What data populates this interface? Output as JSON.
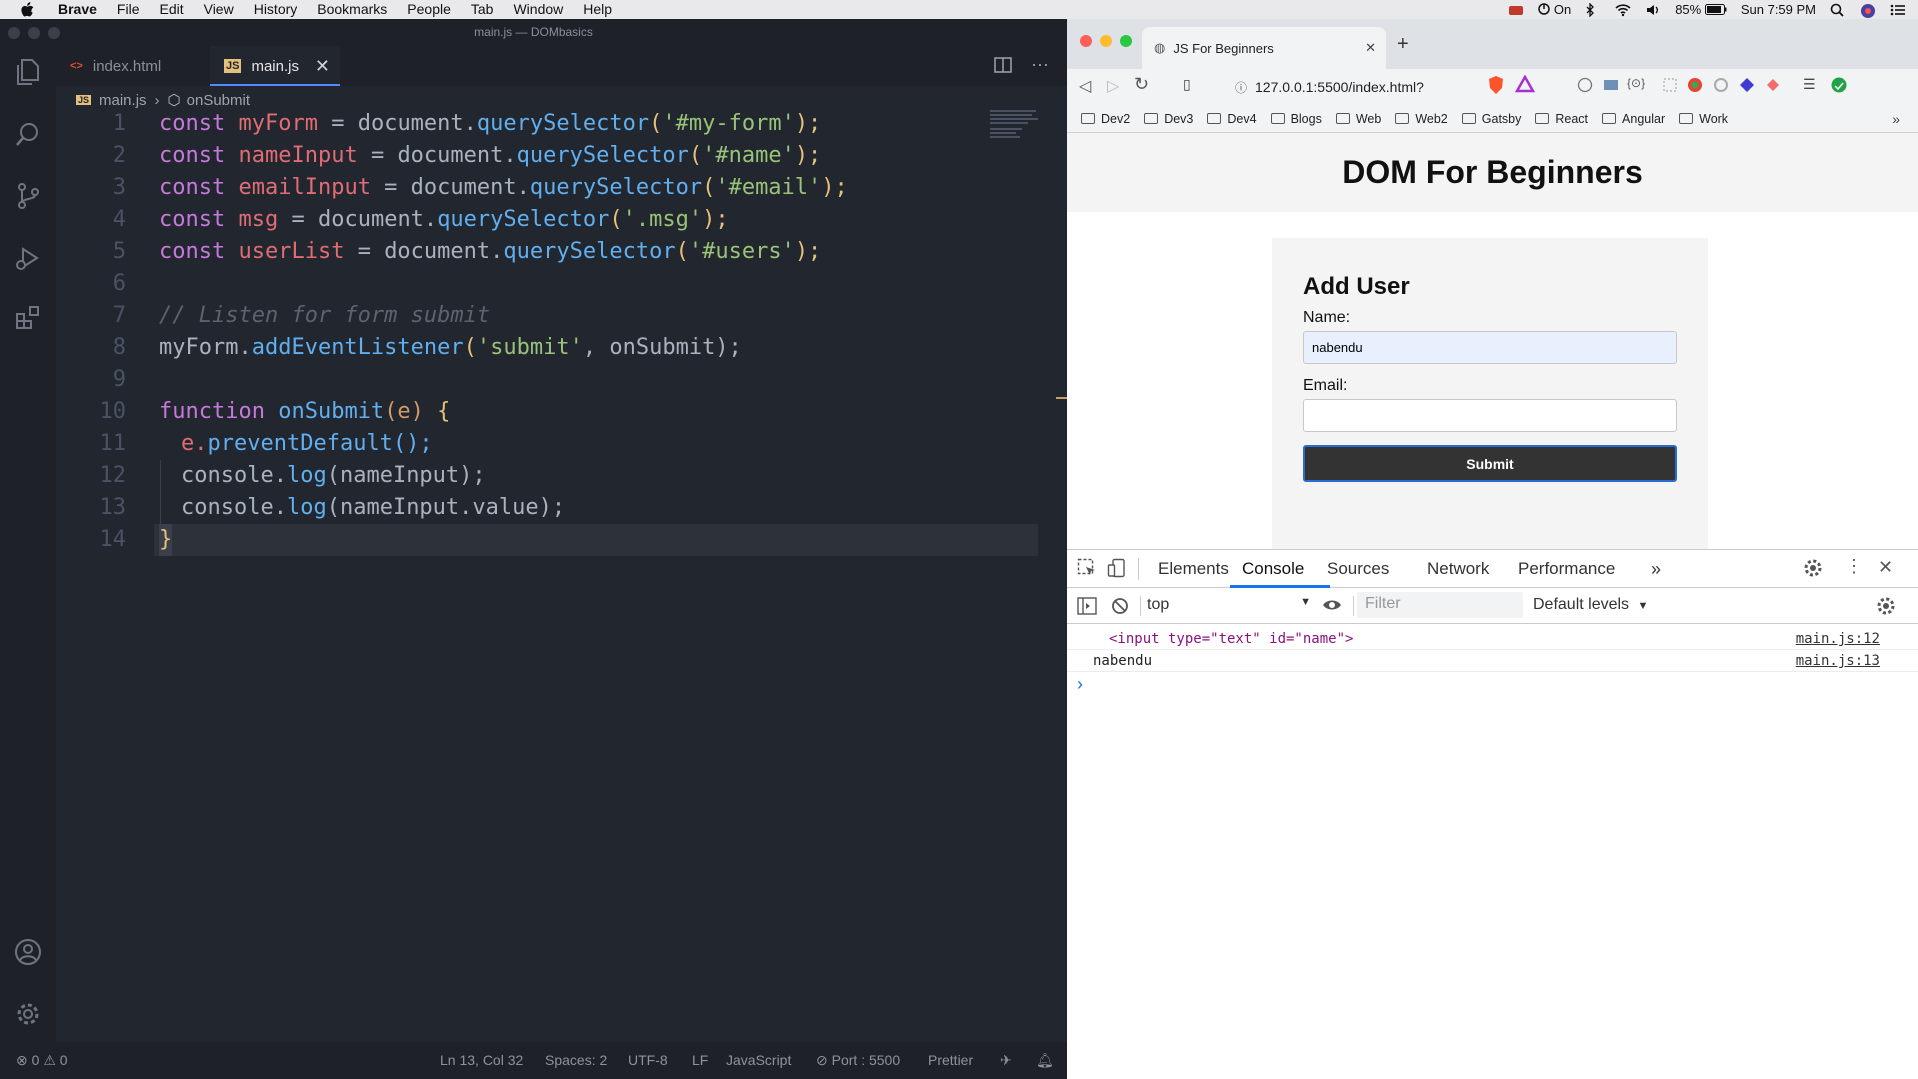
{
  "menubar": {
    "app": "Brave",
    "items": [
      "File",
      "Edit",
      "View",
      "History",
      "Bookmarks",
      "People",
      "Tab",
      "Window",
      "Help"
    ],
    "status": {
      "vpn": "On",
      "battery": "85%",
      "clock": "Sun 7:59 PM"
    }
  },
  "vscode": {
    "title": "main.js — DOMbasics",
    "tabs": [
      {
        "label": "index.html",
        "icon": "html-file-icon"
      },
      {
        "label": "main.js",
        "icon": "js-file-icon"
      }
    ],
    "breadcrumb": {
      "file": "main.js",
      "symbol": "onSubmit"
    },
    "line_numbers": [
      "1",
      "2",
      "3",
      "4",
      "5",
      "6",
      "7",
      "8",
      "9",
      "10",
      "11",
      "12",
      "13",
      "14"
    ],
    "code": {
      "l1": {
        "kw": "const",
        "var": "myForm",
        "eq": " = document.",
        "fn": "querySelector",
        "open": "(",
        "str": "'#my-form'",
        "close": ");"
      },
      "l2": {
        "kw": "const",
        "var": "nameInput",
        "eq": " = document.",
        "fn": "querySelector",
        "open": "(",
        "str": "'#name'",
        "close": ");"
      },
      "l3": {
        "kw": "const",
        "var": "emailInput",
        "eq": " = document.",
        "fn": "querySelector",
        "open": "(",
        "str": "'#email'",
        "close": ");"
      },
      "l4": {
        "kw": "const",
        "var": "msg",
        "eq": " = document.",
        "fn": "querySelector",
        "open": "(",
        "str": "'.msg'",
        "close": ");"
      },
      "l5": {
        "kw": "const",
        "var": "userList",
        "eq": " = document.",
        "fn": "querySelector",
        "open": "(",
        "str": "'#users'",
        "close": ");"
      },
      "l7": "// Listen for form submit",
      "l8": {
        "obj": "myForm.",
        "fn": "addEventListener",
        "open": "(",
        "str": "'submit'",
        "rest": ", onSubmit);"
      },
      "l10": {
        "kw": "function",
        "fn": "onSubmit",
        "param": "(e)",
        "brace": " {"
      },
      "l11": {
        "obj": "e.",
        "fn": "preventDefault",
        "rest": "();"
      },
      "l12": {
        "obj": "console.",
        "fn": "log",
        "rest": "(nameInput);"
      },
      "l13": {
        "obj": "console.",
        "fn": "log",
        "rest": "(nameInput.value);"
      },
      "l14": "}"
    },
    "status": {
      "problems": "0",
      "warnings": "0",
      "cursor": "Ln 13, Col 32",
      "spaces": "Spaces: 2",
      "encoding": "UTF-8",
      "eol": "LF",
      "language": "JavaScript",
      "port": "Port : 5500",
      "formatter": "Prettier"
    }
  },
  "browser": {
    "tab_title": "JS For Beginners",
    "url": "127.0.0.1:5500/index.html?",
    "bookmarks": [
      "Dev2",
      "Dev3",
      "Dev4",
      "Blogs",
      "Web",
      "Web2",
      "Gatsby",
      "React",
      "Angular",
      "Work"
    ],
    "page": {
      "heading": "DOM For Beginners",
      "form_title": "Add User",
      "name_label": "Name:",
      "name_value": "nabendu",
      "email_label": "Email:",
      "email_value": "",
      "submit_label": "Submit"
    }
  },
  "devtools": {
    "tabs": [
      "Elements",
      "Console",
      "Sources",
      "Network",
      "Performance"
    ],
    "active_tab": "Console",
    "context": "top",
    "filter_placeholder": "Filter",
    "levels": "Default levels",
    "logs": [
      {
        "text": "<input type=\"text\" id=\"name\">",
        "source": "main.js:12"
      },
      {
        "text": "nabendu",
        "source": "main.js:13"
      }
    ],
    "prompt": "›"
  }
}
